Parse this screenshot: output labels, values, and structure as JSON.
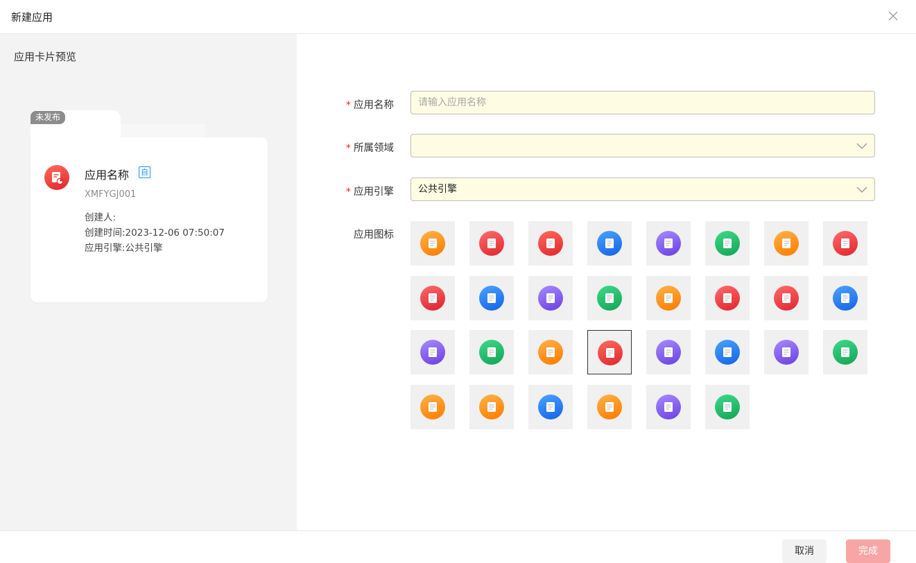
{
  "dialog": {
    "title": "新建应用"
  },
  "preview": {
    "title": "应用卡片预览",
    "status_badge": "未发布",
    "app_name": "应用名称",
    "self_tag": "自",
    "code": "XMFYGJ001",
    "creator_line": "创建人:",
    "created_line": "创建时间:2023-12-06 07:50:07",
    "engine_line": "应用引擎:公共引擎"
  },
  "form": {
    "name": {
      "label": "应用名称",
      "required": "*",
      "value": "",
      "placeholder": "请输入应用名称"
    },
    "domain": {
      "label": "所属领域",
      "required": "*",
      "value": ""
    },
    "engine": {
      "label": "应用引擎",
      "required": "*",
      "value": "公共引擎"
    },
    "icon": {
      "label": "应用图标",
      "selected_index": 19
    }
  },
  "icon_options": [
    {
      "name": "toolbox-icon",
      "colors": [
        "#ffb347",
        "#ff7a00"
      ]
    },
    {
      "name": "monitor-icon",
      "colors": [
        "#ff6b6b",
        "#e0262d"
      ]
    },
    {
      "name": "clipboard-pen-icon",
      "colors": [
        "#ff6b5b",
        "#e0262d"
      ]
    },
    {
      "name": "doc-gear-icon",
      "colors": [
        "#4aa3ff",
        "#1463e6"
      ]
    },
    {
      "name": "clipboard-check-icon",
      "colors": [
        "#a68bff",
        "#6a3fe0"
      ]
    },
    {
      "name": "folder-gear-icon",
      "colors": [
        "#3ed98a",
        "#13a454"
      ]
    },
    {
      "name": "clipboard-plus-icon",
      "colors": [
        "#ffb347",
        "#ff7a00"
      ]
    },
    {
      "name": "box-down-icon",
      "colors": [
        "#ff6b6b",
        "#e0262d"
      ]
    },
    {
      "name": "chart-board-icon",
      "colors": [
        "#ff6b6b",
        "#d9222d"
      ]
    },
    {
      "name": "clipboard-list-icon",
      "colors": [
        "#4aa3ff",
        "#1463e6"
      ]
    },
    {
      "name": "briefcase-icon",
      "colors": [
        "#a68bff",
        "#6a3fe0"
      ]
    },
    {
      "name": "book-icon",
      "colors": [
        "#3ed98a",
        "#13a454"
      ]
    },
    {
      "name": "clipboard-add-icon",
      "colors": [
        "#ffb347",
        "#ff7a00"
      ]
    },
    {
      "name": "package-icon",
      "colors": [
        "#ff6b6b",
        "#e0262d"
      ]
    },
    {
      "name": "grid-icon",
      "colors": [
        "#ff6b6b",
        "#e0262d"
      ]
    },
    {
      "name": "document-icon",
      "colors": [
        "#4aa3ff",
        "#1463e6"
      ]
    },
    {
      "name": "form-icon",
      "colors": [
        "#a68bff",
        "#6a3fe0"
      ]
    },
    {
      "name": "calculator-icon",
      "colors": [
        "#3ed98a",
        "#13a454"
      ]
    },
    {
      "name": "file-icon",
      "colors": [
        "#ffb347",
        "#ff7a00"
      ]
    },
    {
      "name": "file-chart-icon",
      "colors": [
        "#ff6b5b",
        "#e0262d"
      ]
    },
    {
      "name": "inbox-icon",
      "colors": [
        "#a68bff",
        "#6a3fe0"
      ]
    },
    {
      "name": "doc-check-icon",
      "colors": [
        "#4aa3ff",
        "#1463e6"
      ]
    },
    {
      "name": "doc-search-icon",
      "colors": [
        "#a68bff",
        "#6a3fe0"
      ]
    },
    {
      "name": "note-icon",
      "colors": [
        "#3ed98a",
        "#13a454"
      ]
    },
    {
      "name": "magnifier-icon",
      "colors": [
        "#ffb347",
        "#ff7a00"
      ]
    },
    {
      "name": "bar-chart-icon",
      "colors": [
        "#ffb347",
        "#ff7a00"
      ]
    },
    {
      "name": "text-doc-icon",
      "colors": [
        "#4aa3ff",
        "#1463e6"
      ]
    },
    {
      "name": "bar-chart-alt-icon",
      "colors": [
        "#ffb347",
        "#ff7a00"
      ]
    },
    {
      "name": "area-chart-icon",
      "colors": [
        "#a68bff",
        "#6a3fe0"
      ]
    },
    {
      "name": "memo-icon",
      "colors": [
        "#3ed98a",
        "#13a454"
      ]
    }
  ],
  "footer": {
    "cancel_label": "取消",
    "ok_label": "完成"
  }
}
